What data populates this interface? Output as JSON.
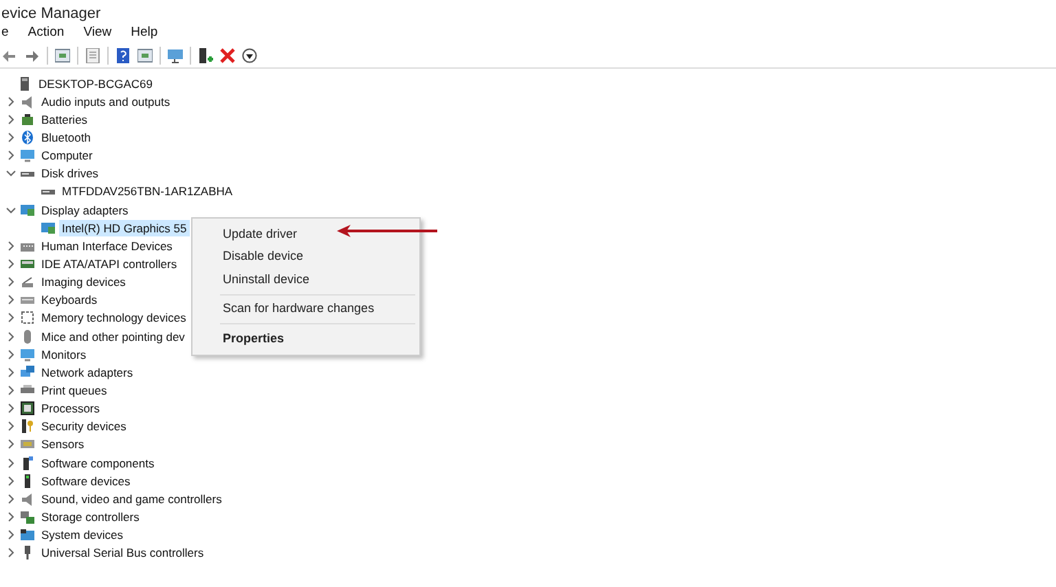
{
  "window": {
    "title": "evice Manager"
  },
  "menu": [
    "e",
    "Action",
    "View",
    "Help"
  ],
  "tree": {
    "label": "DESKTOP-BCGAC69",
    "children": [
      {
        "label": "Audio inputs and outputs",
        "expanded": false
      },
      {
        "label": "Batteries",
        "expanded": false
      },
      {
        "label": "Bluetooth",
        "expanded": false
      },
      {
        "label": "Computer",
        "expanded": false
      },
      {
        "label": "Disk drives",
        "expanded": true,
        "children": [
          {
            "label": "MTFDDAV256TBN-1AR1ZABHA",
            "selected": false
          }
        ]
      },
      {
        "label": "Display adapters",
        "expanded": true,
        "children": [
          {
            "label": "Intel(R) HD Graphics 55",
            "selected": true
          }
        ]
      },
      {
        "label": "Human Interface Devices",
        "expanded": false
      },
      {
        "label": "IDE ATA/ATAPI controllers",
        "expanded": false
      },
      {
        "label": "Imaging devices",
        "expanded": false
      },
      {
        "label": "Keyboards",
        "expanded": false
      },
      {
        "label": "Memory technology devices",
        "expanded": false
      },
      {
        "label": "Mice and other pointing dev",
        "expanded": false
      },
      {
        "label": "Monitors",
        "expanded": false
      },
      {
        "label": "Network adapters",
        "expanded": false
      },
      {
        "label": "Print queues",
        "expanded": false
      },
      {
        "label": "Processors",
        "expanded": false
      },
      {
        "label": "Security devices",
        "expanded": false
      },
      {
        "label": "Sensors",
        "expanded": false
      },
      {
        "label": "Software components",
        "expanded": false
      },
      {
        "label": "Software devices",
        "expanded": false
      },
      {
        "label": "Sound, video and game controllers",
        "expanded": false
      },
      {
        "label": "Storage controllers",
        "expanded": false
      },
      {
        "label": "System devices",
        "expanded": false
      },
      {
        "label": "Universal Serial Bus controllers",
        "expanded": false
      }
    ]
  },
  "context_menu": [
    {
      "label": "Update driver",
      "separator_before": false,
      "default": false
    },
    {
      "label": "Disable device",
      "separator_before": false,
      "default": false
    },
    {
      "label": "Uninstall device",
      "separator_before": false,
      "default": false
    },
    {
      "label": "Scan for hardware changes",
      "separator_before": true,
      "default": false
    },
    {
      "label": "Properties",
      "separator_before": true,
      "default": true
    }
  ]
}
